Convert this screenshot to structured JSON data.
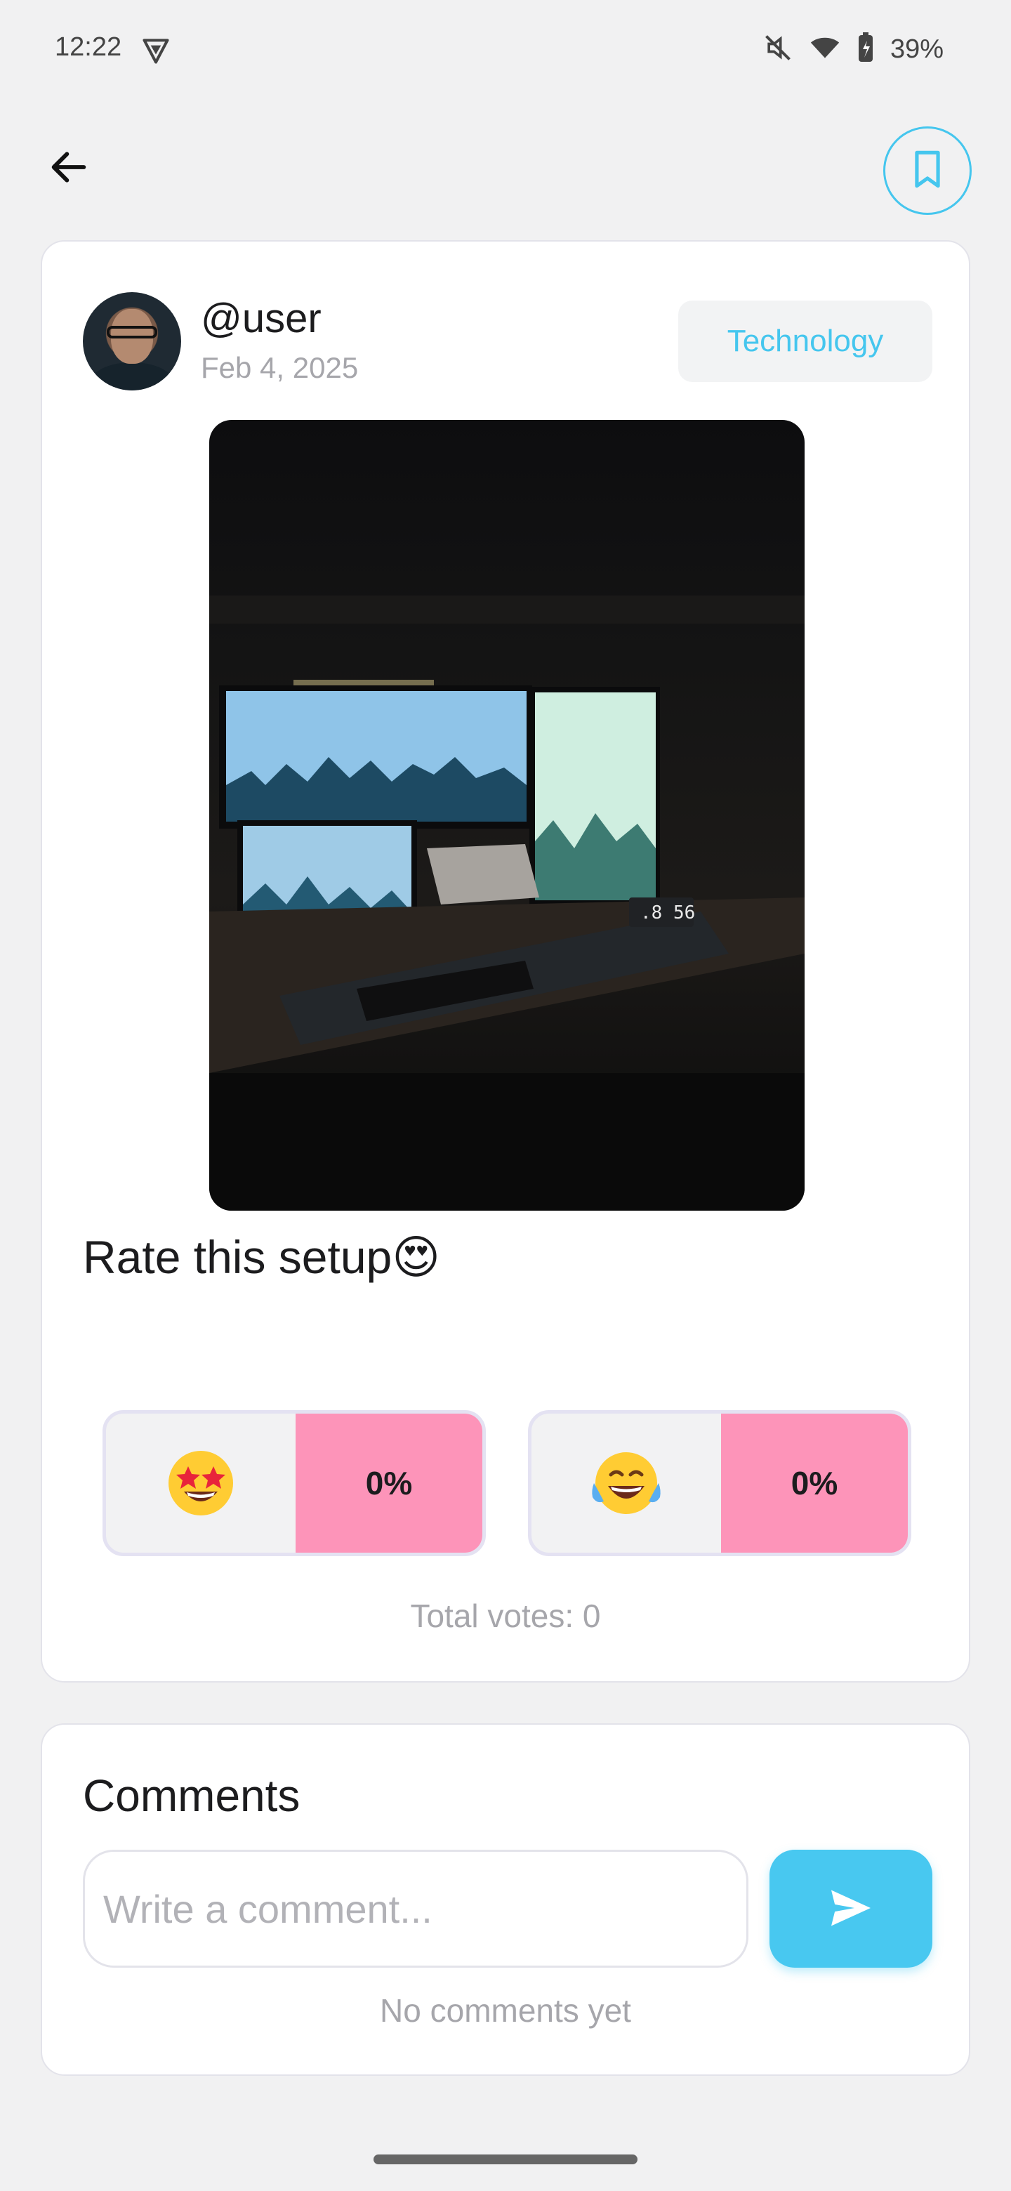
{
  "status_bar": {
    "time": "12:22",
    "battery": "39%",
    "icons": [
      "vpn-icon",
      "mute-icon",
      "wifi-icon",
      "battery-icon"
    ]
  },
  "nav": {
    "back_icon": "arrow-left-icon",
    "bookmark_icon": "bookmark-icon",
    "accent_color": "#45c6ee"
  },
  "post": {
    "username": "@user",
    "date": "Feb 4, 2025",
    "category": "Technology",
    "caption": "Rate this setup😍",
    "image_desc_icon": "desk-setup-photo",
    "votes": [
      {
        "emoji": "🤩",
        "percent": "0%"
      },
      {
        "emoji": "😂",
        "percent": "0%"
      }
    ],
    "total_votes": "Total votes: 0",
    "vote_bar_color": "#fd94b9"
  },
  "comments": {
    "title": "Comments",
    "placeholder": "Write a comment...",
    "empty_text": "No comments yet",
    "send_icon": "send-icon",
    "send_color": "#48c8f0"
  }
}
